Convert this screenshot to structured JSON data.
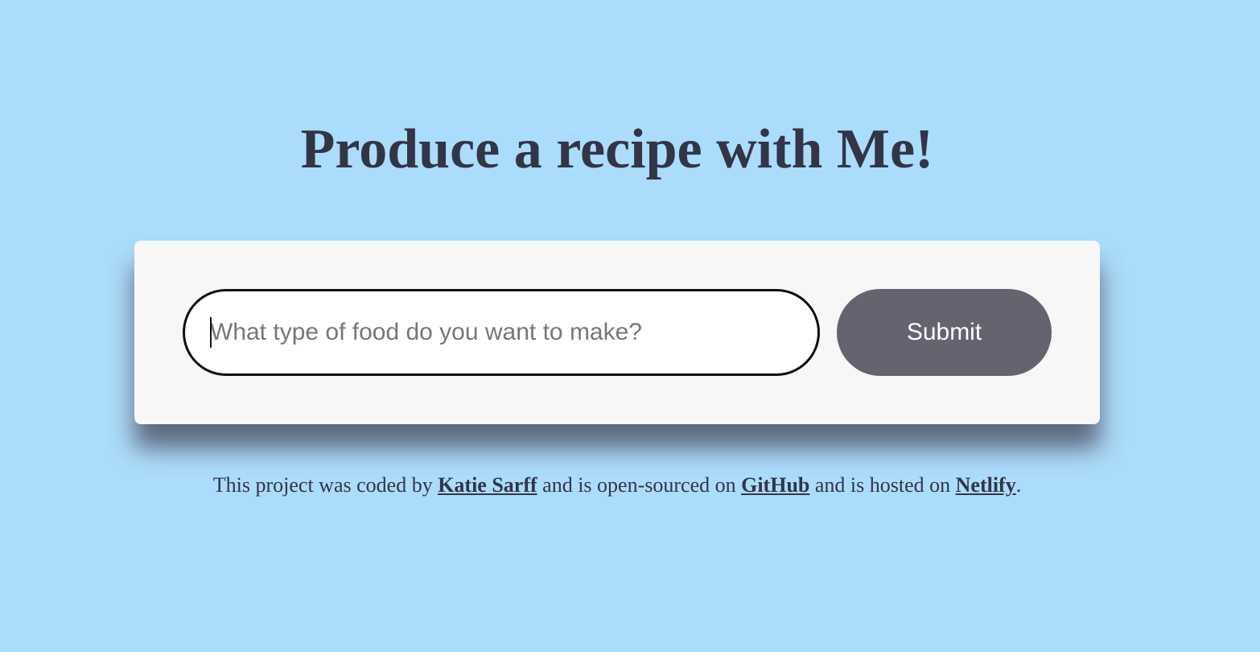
{
  "page": {
    "title": "Produce a recipe with Me!"
  },
  "search": {
    "value": "",
    "placeholder": "What type of food do you want to make?",
    "submit_label": "Submit"
  },
  "footer": {
    "text_1": "This project was coded by ",
    "author_link": "Katie Sarff",
    "text_2": " and is open-sourced on ",
    "github_link": "GitHub",
    "text_3": " and is hosted on ",
    "netlify_link": "Netlify",
    "text_4": "."
  },
  "colors": {
    "background": "#acdcfb",
    "card": "#f7f7f7",
    "text": "#323546",
    "button": "#63646f"
  }
}
